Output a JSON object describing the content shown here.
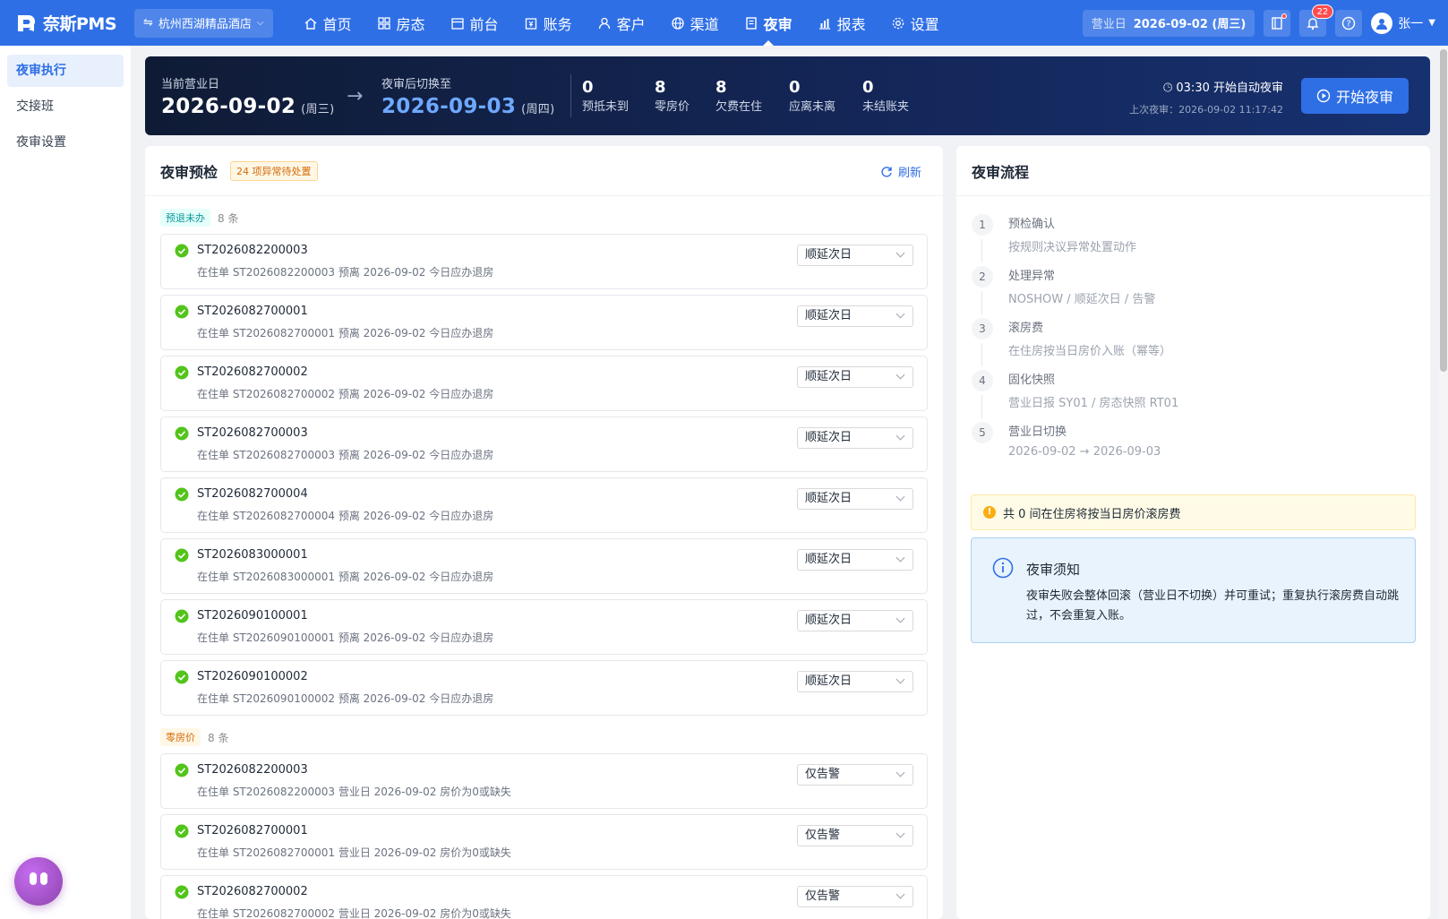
{
  "app": {
    "logo_text": "奈斯PMS",
    "hotel": "杭州西湖精品酒店",
    "nav": [
      {
        "label": "首页",
        "icon": "home-icon"
      },
      {
        "label": "房态",
        "icon": "grid-icon"
      },
      {
        "label": "前台",
        "icon": "calendar-icon"
      },
      {
        "label": "账务",
        "icon": "ledger-icon"
      },
      {
        "label": "客户",
        "icon": "user-icon"
      },
      {
        "label": "渠道",
        "icon": "globe-icon"
      },
      {
        "label": "夜审",
        "icon": "audit-icon",
        "active": true
      },
      {
        "label": "报表",
        "icon": "chart-icon"
      },
      {
        "label": "设置",
        "icon": "gear-icon"
      }
    ],
    "bizdate_label": "营业日",
    "bizdate_value": "2026-09-02 (周三)",
    "notification_count": "22",
    "user_name": "张一",
    "brand_color": "#2f6fe6"
  },
  "sidebar": {
    "items": [
      {
        "label": "夜审执行",
        "active": true
      },
      {
        "label": "交接班"
      },
      {
        "label": "夜审设置"
      }
    ]
  },
  "banner": {
    "current_label": "当前营业日",
    "current_date": "2026-09-02",
    "current_weekday": "(周三)",
    "next_label": "夜审后切换至",
    "next_date": "2026-09-03",
    "next_weekday": "(周四)",
    "stats": [
      {
        "num": "0",
        "label": "预抵未到"
      },
      {
        "num": "8",
        "label": "零房价"
      },
      {
        "num": "8",
        "label": "欠费在住"
      },
      {
        "num": "0",
        "label": "应离未离"
      },
      {
        "num": "0",
        "label": "未结账夹"
      }
    ],
    "auto_audit": "03:30 开始自动夜审",
    "last_audit": "上次夜审：2026-09-02 11:17:42",
    "start_button": "开始夜审"
  },
  "precheck": {
    "title": "夜审预检",
    "warning_tag": "24 项异常待处置",
    "refresh_label": "刷新",
    "groups": [
      {
        "tag": "预退未办",
        "count": "8 条",
        "rows": [
          {
            "id": "ST2026082200003",
            "desc": "在住单 ST2026082200003 预离 2026-09-02 今日应办退房",
            "action": "顺延次日"
          },
          {
            "id": "ST2026082700001",
            "desc": "在住单 ST2026082700001 预离 2026-09-02 今日应办退房",
            "action": "顺延次日"
          },
          {
            "id": "ST2026082700002",
            "desc": "在住单 ST2026082700002 预离 2026-09-02 今日应办退房",
            "action": "顺延次日"
          },
          {
            "id": "ST2026082700003",
            "desc": "在住单 ST2026082700003 预离 2026-09-02 今日应办退房",
            "action": "顺延次日"
          },
          {
            "id": "ST2026082700004",
            "desc": "在住单 ST2026082700004 预离 2026-09-02 今日应办退房",
            "action": "顺延次日"
          },
          {
            "id": "ST2026083000001",
            "desc": "在住单 ST2026083000001 预离 2026-09-02 今日应办退房",
            "action": "顺延次日"
          },
          {
            "id": "ST2026090100001",
            "desc": "在住单 ST2026090100001 预离 2026-09-02 今日应办退房",
            "action": "顺延次日"
          },
          {
            "id": "ST2026090100002",
            "desc": "在住单 ST2026090100002 预离 2026-09-02 今日应办退房",
            "action": "顺延次日"
          }
        ]
      },
      {
        "tag": "零房价",
        "count": "8 条",
        "rows": [
          {
            "id": "ST2026082200003",
            "desc": "在住单 ST2026082200003 营业日 2026-09-02 房价为0或缺失",
            "action": "仅告警"
          },
          {
            "id": "ST2026082700001",
            "desc": "在住单 ST2026082700001 营业日 2026-09-02 房价为0或缺失",
            "action": "仅告警"
          },
          {
            "id": "ST2026082700002",
            "desc": "在住单 ST2026082700002 营业日 2026-09-02 房价为0或缺失",
            "action": "仅告警"
          }
        ]
      }
    ]
  },
  "flow": {
    "title": "夜审流程",
    "steps": [
      {
        "num": "1",
        "title": "预检确认",
        "sub": "按规则决议异常处置动作"
      },
      {
        "num": "2",
        "title": "处理异常",
        "sub": "NOSHOW / 顺延次日 / 告警"
      },
      {
        "num": "3",
        "title": "滚房费",
        "sub": "在住房按当日房价入账（幂等）"
      },
      {
        "num": "4",
        "title": "固化快照",
        "sub": "营业日报 SY01 / 房态快照 RT01"
      },
      {
        "num": "5",
        "title": "营业日切换",
        "sub": "2026-09-02 → 2026-09-03"
      }
    ],
    "warn_notice": "共 0 间在住房将按当日房价滚房费",
    "info_title": "夜审须知",
    "info_text": "夜审失败会整体回滚（营业日不切换）并可重试；重复执行滚房费自动跳过，不会重复入账。"
  }
}
